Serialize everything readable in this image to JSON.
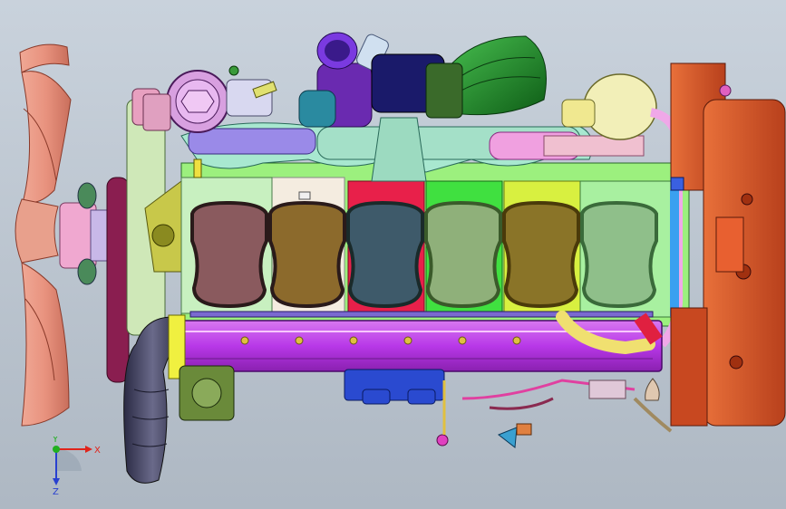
{
  "view": {
    "background_top": "#c9d2dc",
    "background_bottom": "#aeb8c3"
  },
  "triad": {
    "x_label": "X",
    "y_label": "Y",
    "z_label": "Z",
    "x_color": "#e0241b",
    "y_color": "#20b020",
    "z_color": "#2840d0"
  },
  "cylinders": [
    {
      "color": "#8a5a5e"
    },
    {
      "color": "#8c6a2c"
    },
    {
      "color": "#3e5a6a"
    },
    {
      "color": "#8fb07a"
    },
    {
      "color": "#8a7428"
    },
    {
      "color": "#8fbf8a"
    }
  ],
  "colors": {
    "fan": "#e8927e",
    "block": "#9cf07e",
    "manifold": "#a4e0c8",
    "rail": "#b838e8",
    "flywheel_housing": "#d8562a",
    "turbo_housing": "#1c8a26",
    "filter": "#f2efb8",
    "intake_pipe": "#40405e",
    "pulley": "#8a1e50"
  }
}
